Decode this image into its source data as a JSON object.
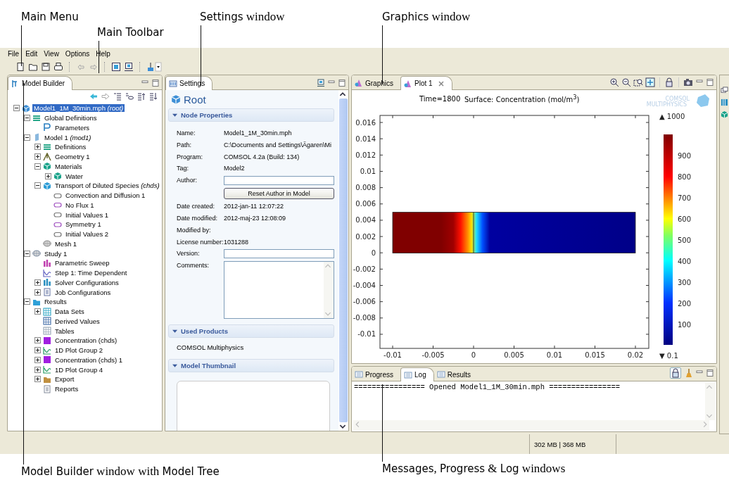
{
  "annotations": [
    {
      "parts": [
        {
          "text": "Main Menu",
          "kind": "ui"
        }
      ]
    },
    {
      "parts": [
        {
          "text": "Main Toolbar",
          "kind": "ui"
        }
      ]
    },
    {
      "parts": [
        {
          "text": "Settings",
          "kind": "ui"
        },
        {
          "text": " window",
          "kind": "prose"
        }
      ]
    },
    {
      "parts": [
        {
          "text": "Graphics",
          "kind": "ui"
        },
        {
          "text": " window",
          "kind": "prose"
        }
      ]
    },
    {
      "parts": [
        {
          "text": "Model Builder",
          "kind": "ui"
        },
        {
          "text": " window with ",
          "kind": "prose"
        },
        {
          "text": "Model Tree",
          "kind": "ui"
        }
      ]
    },
    {
      "parts": [
        {
          "text": "Messages",
          "kind": "ui"
        },
        {
          "text": ", ",
          "kind": "prose"
        },
        {
          "text": "Progress",
          "kind": "ui"
        },
        {
          "text": " & ",
          "kind": "prose"
        },
        {
          "text": "Log",
          "kind": "ui"
        },
        {
          "text": " windows",
          "kind": "prose"
        }
      ]
    }
  ],
  "menu": [
    "File",
    "Edit",
    "View",
    "Options",
    "Help"
  ],
  "model_builder": {
    "tabs": [
      {
        "label": "Model Builder",
        "selected": true
      }
    ],
    "tree": [
      {
        "label": "Model1_1M_30min.mph *(root)*",
        "kind": "root",
        "selected": true,
        "expanded": true,
        "children": [
          {
            "label": "Global Definitions",
            "kind": "globaldefs",
            "selected": false,
            "expanded": true,
            "children": [
              {
                "label": "Parameters",
                "kind": "param",
                "selected": false
              }
            ]
          },
          {
            "label": "Model 1 *(mod1)*",
            "kind": "model",
            "selected": false,
            "expanded": true,
            "children": [
              {
                "label": "Definitions",
                "kind": "definitions",
                "selected": false,
                "expanded": false
              },
              {
                "label": "Geometry 1",
                "kind": "geometry",
                "selected": false,
                "expanded": false
              },
              {
                "label": "Materials",
                "kind": "materials",
                "selected": false,
                "expanded": true,
                "children": [
                  {
                    "label": "Water",
                    "kind": "materials",
                    "selected": false,
                    "expanded": false
                  }
                ]
              },
              {
                "label": "Transport of Diluted Species *(chds)*",
                "kind": "physics",
                "selected": false,
                "expanded": true,
                "children": [
                  {
                    "label": "Convection and Diffusion 1",
                    "kind": "feature",
                    "selected": false
                  },
                  {
                    "label": "No Flux 1",
                    "kind": "boundary",
                    "selected": false
                  },
                  {
                    "label": "Initial Values 1",
                    "kind": "feature",
                    "selected": false
                  },
                  {
                    "label": "Symmetry 1",
                    "kind": "boundary",
                    "selected": false
                  },
                  {
                    "label": "Initial Values 2",
                    "kind": "feature",
                    "selected": false
                  }
                ]
              },
              {
                "label": "Mesh 1",
                "kind": "mesh",
                "selected": false
              }
            ]
          },
          {
            "label": "Study 1",
            "kind": "study",
            "selected": false,
            "expanded": true,
            "children": [
              {
                "label": "Parametric Sweep",
                "kind": "sweep",
                "selected": false
              },
              {
                "label": "Step 1: Time Dependent",
                "kind": "step",
                "selected": false
              },
              {
                "label": "Solver Configurations",
                "kind": "solver",
                "selected": false,
                "expanded": false
              },
              {
                "label": "Job Configurations",
                "kind": "job",
                "selected": false,
                "expanded": false
              }
            ]
          },
          {
            "label": "Results",
            "kind": "results",
            "selected": false,
            "expanded": true,
            "children": [
              {
                "label": "Data Sets",
                "kind": "datasets",
                "selected": false,
                "expanded": false
              },
              {
                "label": "Derived Values",
                "kind": "derived",
                "selected": false
              },
              {
                "label": "Tables",
                "kind": "tables",
                "selected": false
              },
              {
                "label": "Concentration (chds)",
                "kind": "surface",
                "selected": false,
                "expanded": false
              },
              {
                "label": "1D Plot Group 2",
                "kind": "plot1d",
                "selected": false,
                "expanded": false
              },
              {
                "label": "Concentration (chds) 1",
                "kind": "surface",
                "selected": false,
                "expanded": false
              },
              {
                "label": "1D Plot Group 4",
                "kind": "plot1d",
                "selected": false,
                "expanded": false
              },
              {
                "label": "Export",
                "kind": "export",
                "selected": false,
                "expanded": false
              },
              {
                "label": "Reports",
                "kind": "reports",
                "selected": false
              }
            ]
          }
        ]
      }
    ]
  },
  "settings": {
    "tabs": [
      {
        "label": "Settings",
        "selected": true
      }
    ],
    "title": "Root",
    "sections": [
      {
        "title": "Node Properties",
        "kind": "properties",
        "expanded": true,
        "rows": [
          {
            "kind": "text",
            "label": "Name:",
            "value": "Model1_1M_30min.mph"
          },
          {
            "kind": "text",
            "label": "Path:",
            "value": "C:\\Documents and Settings\\Ägaren\\Mi"
          },
          {
            "kind": "text",
            "label": "Program:",
            "value": "COMSOL 4.2a (Build: 134)"
          },
          {
            "kind": "text",
            "label": "Tag:",
            "value": "Model2"
          },
          {
            "kind": "input",
            "label": "Author:"
          },
          {
            "kind": "button",
            "value": "Reset Author in Model"
          },
          {
            "kind": "text",
            "label": "Date created:",
            "value": "2012-jan-11 12:07:22"
          },
          {
            "kind": "text",
            "label": "Date modified:",
            "value": "2012-maj-23 12:08:09"
          },
          {
            "kind": "text",
            "label": "Modified by:"
          },
          {
            "kind": "text",
            "label": "License number:",
            "value": "1031288"
          },
          {
            "kind": "input",
            "label": "Version:"
          },
          {
            "kind": "textarea",
            "label": "Comments:"
          }
        ]
      },
      {
        "title": "Used Products",
        "kind": "text",
        "expanded": true,
        "text": "COMSOL Multiphysics"
      },
      {
        "title": "Model Thumbnail",
        "kind": "thumbnail",
        "expanded": true
      }
    ]
  },
  "graphics": {
    "tabs": [
      {
        "label": "Graphics",
        "selected": false,
        "closable": false
      },
      {
        "label": "Plot 1",
        "selected": true,
        "closable": true
      }
    ],
    "plot": {
      "time": "Time=1800",
      "title": "Surface: Concentration (mol/m$^{3}$)",
      "logo": [
        "COMSOL",
        "MULTIPHYSICS"
      ],
      "yticks": [
        "0.016",
        "0.014",
        "0.012",
        "0.01",
        "0.008",
        "0.006",
        "0.004",
        "0.002",
        "0",
        "-0.002",
        "-0.004",
        "-0.006",
        "-0.008",
        "-0.01"
      ],
      "xticks": [
        "-0.01",
        "-0.005",
        "0",
        "0.005",
        "0.01",
        "0.015",
        "0.02"
      ],
      "colorbar": {
        "max": "▲ 1000",
        "min": "▼ 0.1",
        "labels": [
          "900",
          "800",
          "700",
          "600",
          "500",
          "400",
          "300",
          "200",
          "100"
        ]
      }
    }
  },
  "messages": {
    "tabs": [
      {
        "label": "Progress",
        "selected": false
      },
      {
        "label": "Log",
        "selected": true
      },
      {
        "label": "Results",
        "selected": false
      }
    ],
    "log": [
      "================ Opened Model1_1M_30min.mph ================"
    ]
  },
  "status_bar": {
    "memory": "302 MB | 368 MB"
  }
}
